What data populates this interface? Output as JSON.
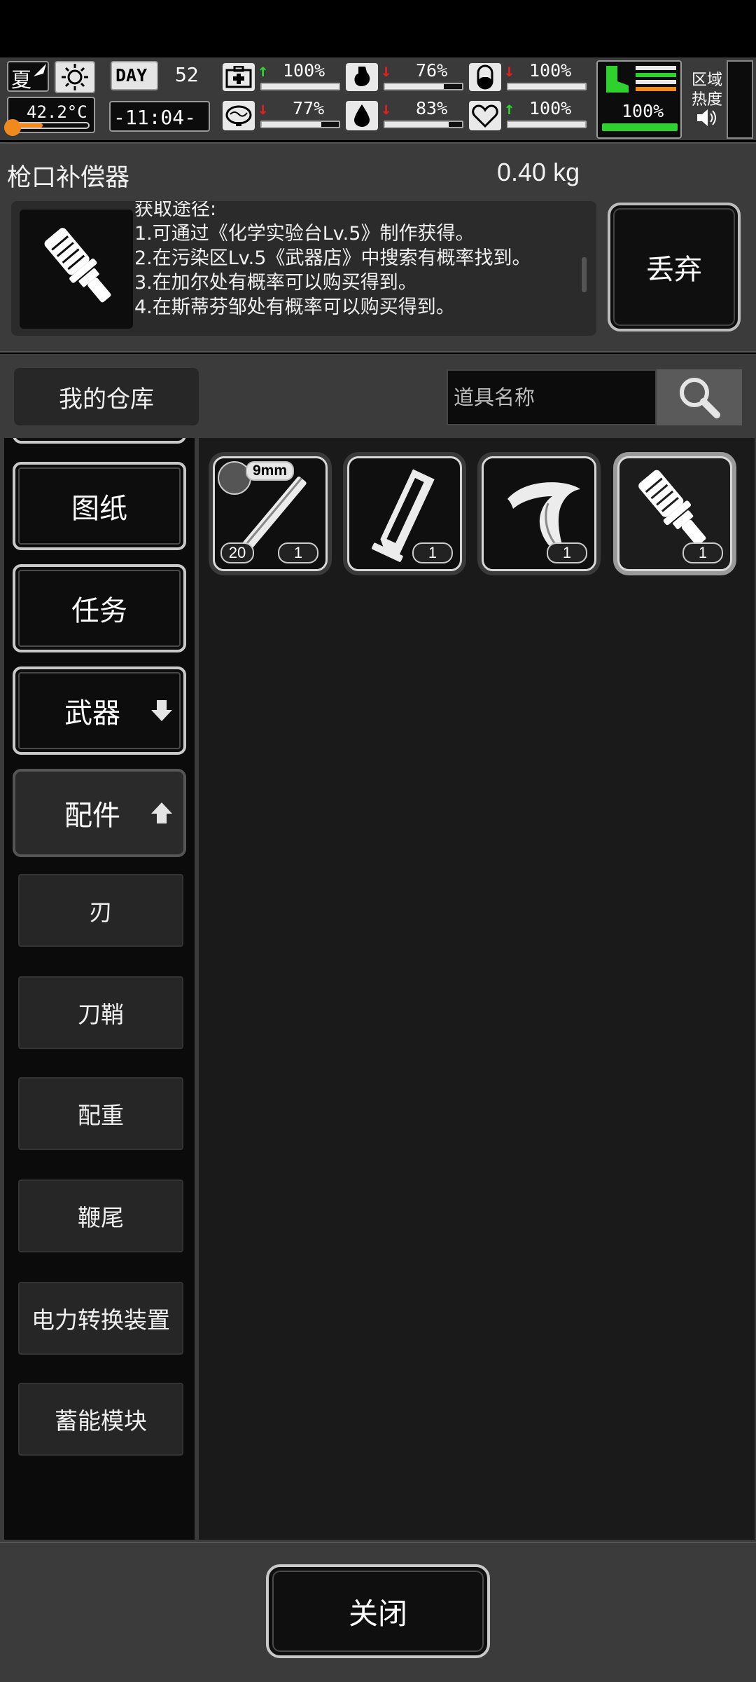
{
  "hud": {
    "season": "夏",
    "temperature": "42.2°C",
    "day_label": "DAY",
    "day_number": "52",
    "time": "-11:04-",
    "region_heat_label_1": "区域",
    "region_heat_label_2": "热度",
    "stats": [
      {
        "icon": "medkit-icon",
        "trend": "up",
        "value": "100%",
        "level": 1.0
      },
      {
        "icon": "stomach-icon",
        "trend": "down",
        "value": "76%",
        "level": 0.76
      },
      {
        "icon": "capsule-icon",
        "trend": "down",
        "value": "100%",
        "level": 1.0
      },
      {
        "icon": "brain-icon",
        "trend": "down",
        "value": "77%",
        "level": 0.77
      },
      {
        "icon": "water-drop-icon",
        "trend": "down",
        "value": "83%",
        "level": 0.83
      },
      {
        "icon": "heart-icon",
        "trend": "up",
        "value": "100%",
        "level": 1.0
      }
    ],
    "stamina_value": "100%",
    "stamina_level": 1.0
  },
  "item": {
    "name": "枪口补偿器",
    "weight": "0.40 kg",
    "description_lines": [
      "获取途径:",
      "1.可通过《化学实验台Lv.5》制作获得。",
      "2.在污染区Lv.5《武器店》中搜索有概率找到。",
      "3.在加尔处有概率可以购买得到。",
      "4.在斯蒂芬邹处有概率可以购买得到。"
    ],
    "discard_label": "丢弃"
  },
  "warehouse": {
    "tab_label": "我的仓库",
    "search_placeholder": "道具名称"
  },
  "categories": [
    {
      "label": "图纸"
    },
    {
      "label": "任务"
    },
    {
      "label": "武器"
    },
    {
      "label": "配件"
    }
  ],
  "subcategories": [
    {
      "label": "刃"
    },
    {
      "label": "刀鞘"
    },
    {
      "label": "配重"
    },
    {
      "label": "鞭尾"
    },
    {
      "label": "电力转换装置"
    },
    {
      "label": "蓄能模块"
    }
  ],
  "inventory": [
    {
      "name": "rifle-barrel-icon",
      "caliber": "9mm",
      "ammo": "20",
      "qty": "1"
    },
    {
      "name": "magazine-icon",
      "qty": "1"
    },
    {
      "name": "hook-blade-icon",
      "qty": "1"
    },
    {
      "name": "muzzle-compensator-icon",
      "qty": "1",
      "selected": true
    }
  ],
  "footer": {
    "close_label": "关闭"
  }
}
